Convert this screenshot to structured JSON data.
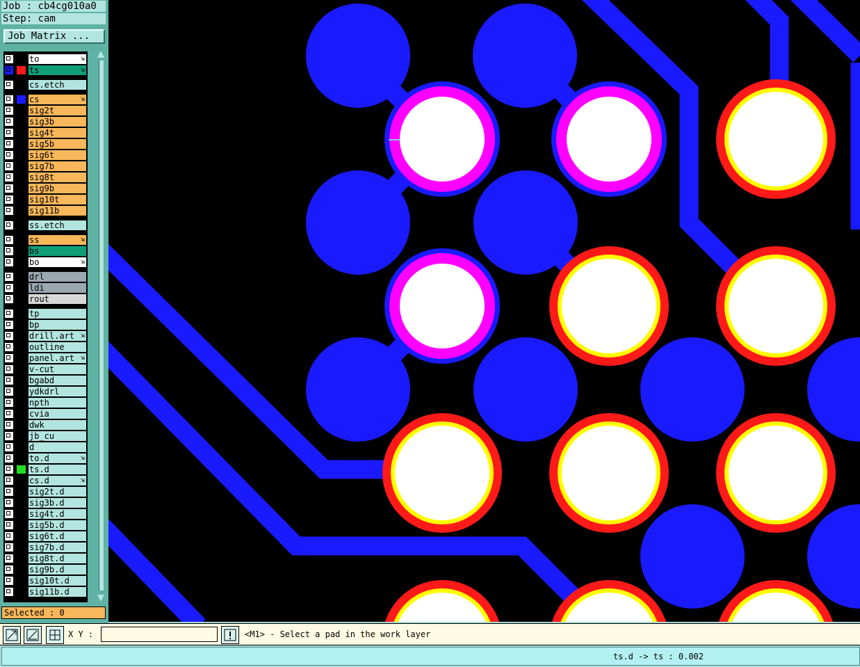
{
  "header": {
    "job_line": "Job : cb4cg010a0",
    "step_line": "Step: cam",
    "job_matrix_label": "Job Matrix ..."
  },
  "layers": [
    {
      "name": "to",
      "color": "#ffffff",
      "arrow": true,
      "swatch": "#000000",
      "checked": false
    },
    {
      "name": "ts",
      "color": "#10a078",
      "arrow": true,
      "swatch": "#ff1a1a",
      "checked": true
    },
    {
      "name": "cs.etch",
      "color": "#b3e5e0",
      "arrow": false,
      "swatch": "#000000",
      "checked": false
    },
    {
      "name": "cs",
      "color": "#f8b75a",
      "arrow": true,
      "swatch": "#1a1aff",
      "checked": false
    },
    {
      "name": "sig2t",
      "color": "#f8b75a",
      "arrow": false,
      "swatch": "#000000",
      "checked": false
    },
    {
      "name": "sig3b",
      "color": "#f8b75a",
      "arrow": false,
      "swatch": "#000000",
      "checked": false
    },
    {
      "name": "sig4t",
      "color": "#f8b75a",
      "arrow": false,
      "swatch": "#000000",
      "checked": false
    },
    {
      "name": "sig5b",
      "color": "#f8b75a",
      "arrow": false,
      "swatch": "#000000",
      "checked": false
    },
    {
      "name": "sig6t",
      "color": "#f8b75a",
      "arrow": false,
      "swatch": "#000000",
      "checked": false
    },
    {
      "name": "sig7b",
      "color": "#f8b75a",
      "arrow": false,
      "swatch": "#000000",
      "checked": false
    },
    {
      "name": "sig8t",
      "color": "#f8b75a",
      "arrow": false,
      "swatch": "#000000",
      "checked": false
    },
    {
      "name": "sig9b",
      "color": "#f8b75a",
      "arrow": false,
      "swatch": "#000000",
      "checked": false
    },
    {
      "name": "sig10t",
      "color": "#f8b75a",
      "arrow": false,
      "swatch": "#000000",
      "checked": false
    },
    {
      "name": "sig11b",
      "color": "#f8b75a",
      "arrow": false,
      "swatch": "#000000",
      "checked": false
    },
    {
      "name": "ss.etch",
      "color": "#b3e5e0",
      "arrow": false,
      "swatch": "#000000",
      "checked": false
    },
    {
      "name": "ss",
      "color": "#f8b75a",
      "arrow": true,
      "swatch": "#000000",
      "checked": false
    },
    {
      "name": "bs",
      "color": "#10a078",
      "arrow": false,
      "swatch": "#000000",
      "checked": false
    },
    {
      "name": "bo",
      "color": "#ffffff",
      "arrow": true,
      "swatch": "#000000",
      "checked": false
    },
    {
      "name": "drl",
      "color": "#9aa8b0",
      "arrow": false,
      "swatch": "#000000",
      "checked": false
    },
    {
      "name": "ldi",
      "color": "#9aa8b0",
      "arrow": false,
      "swatch": "#000000",
      "checked": false
    },
    {
      "name": "rout",
      "color": "#d8d8d8",
      "arrow": false,
      "swatch": "#000000",
      "checked": false
    },
    {
      "name": "tp",
      "color": "#b3e5e0",
      "arrow": false,
      "swatch": "#000000",
      "checked": false
    },
    {
      "name": "bp",
      "color": "#b3e5e0",
      "arrow": false,
      "swatch": "#000000",
      "checked": false
    },
    {
      "name": "drill.art",
      "color": "#b3e5e0",
      "arrow": true,
      "swatch": "#000000",
      "checked": false
    },
    {
      "name": "outline",
      "color": "#b3e5e0",
      "arrow": false,
      "swatch": "#000000",
      "checked": false
    },
    {
      "name": "panel.art",
      "color": "#b3e5e0",
      "arrow": true,
      "swatch": "#000000",
      "checked": false
    },
    {
      "name": "v-cut",
      "color": "#b3e5e0",
      "arrow": false,
      "swatch": "#000000",
      "checked": false
    },
    {
      "name": "bgabd",
      "color": "#b3e5e0",
      "arrow": false,
      "swatch": "#000000",
      "checked": false
    },
    {
      "name": "ydkdrl",
      "color": "#b3e5e0",
      "arrow": false,
      "swatch": "#000000",
      "checked": false
    },
    {
      "name": "npth",
      "color": "#b3e5e0",
      "arrow": false,
      "swatch": "#000000",
      "checked": false
    },
    {
      "name": "cvia",
      "color": "#b3e5e0",
      "arrow": false,
      "swatch": "#000000",
      "checked": false
    },
    {
      "name": "dwk",
      "color": "#b3e5e0",
      "arrow": false,
      "swatch": "#000000",
      "checked": false
    },
    {
      "name": "jb_cu",
      "color": "#b3e5e0",
      "arrow": false,
      "swatch": "#000000",
      "checked": false
    },
    {
      "name": "d",
      "color": "#b3e5e0",
      "arrow": false,
      "swatch": "#000000",
      "checked": false
    },
    {
      "name": "to.d",
      "color": "#b3e5e0",
      "arrow": true,
      "swatch": "#000000",
      "checked": false
    },
    {
      "name": "ts.d",
      "color": "#b3e5e0",
      "arrow": false,
      "swatch": "#22dd22",
      "checked": false
    },
    {
      "name": "cs.d",
      "color": "#b3e5e0",
      "arrow": true,
      "swatch": "#000000",
      "checked": false
    },
    {
      "name": "sig2t.d",
      "color": "#b3e5e0",
      "arrow": false,
      "swatch": "#000000",
      "checked": false
    },
    {
      "name": "sig3b.d",
      "color": "#b3e5e0",
      "arrow": false,
      "swatch": "#000000",
      "checked": false
    },
    {
      "name": "sig4t.d",
      "color": "#b3e5e0",
      "arrow": false,
      "swatch": "#000000",
      "checked": false
    },
    {
      "name": "sig5b.d",
      "color": "#b3e5e0",
      "arrow": false,
      "swatch": "#000000",
      "checked": false
    },
    {
      "name": "sig6t.d",
      "color": "#b3e5e0",
      "arrow": false,
      "swatch": "#000000",
      "checked": false
    },
    {
      "name": "sig7b.d",
      "color": "#b3e5e0",
      "arrow": false,
      "swatch": "#000000",
      "checked": false
    },
    {
      "name": "sig8t.d",
      "color": "#b3e5e0",
      "arrow": false,
      "swatch": "#000000",
      "checked": false
    },
    {
      "name": "sig9b.d",
      "color": "#b3e5e0",
      "arrow": false,
      "swatch": "#000000",
      "checked": false
    },
    {
      "name": "sig10t.d",
      "color": "#b3e5e0",
      "arrow": false,
      "swatch": "#000000",
      "checked": false
    },
    {
      "name": "sig11b.d",
      "color": "#b3e5e0",
      "arrow": false,
      "swatch": "#000000",
      "checked": false
    }
  ],
  "selected_label": "Selected : 0",
  "toolbar": {
    "xy_label": "X Y :",
    "xy_value": "",
    "prompt": "<M1> - Select a pad in the work layer"
  },
  "status": {
    "text": "ts.d -> ts : 0.002"
  },
  "colors": {
    "trace": "#1a1aff",
    "pad_hole": "#ffffff",
    "ring_red": "#ff1a1a",
    "ring_yellow": "#ffff00",
    "ring_magenta": "#ff00ff",
    "background": "#000000"
  },
  "icons": [
    "zoom-fit-icon",
    "measure-icon",
    "grid-snap-icon",
    "alert-icon"
  ]
}
